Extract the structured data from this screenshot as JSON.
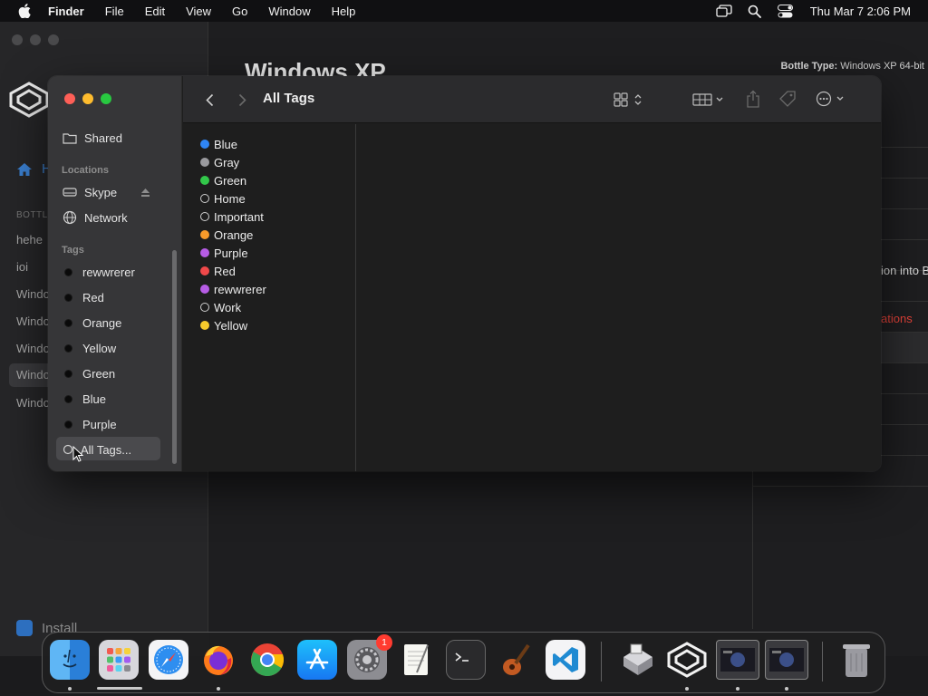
{
  "menubar": {
    "app_name": "Finder",
    "items": [
      "File",
      "Edit",
      "View",
      "Go",
      "Window",
      "Help"
    ],
    "clock": "Thu Mar 7  2:06 PM"
  },
  "background_app": {
    "title": "Windows XP",
    "bottle_type_label": "Bottle Type:",
    "bottle_type_value": "Windows XP 64-bit",
    "sidebar_section": "BOTTLES",
    "sidebar_items": [
      "hehe",
      "ioi",
      "Windows",
      "Windows",
      "Windows",
      "Windows",
      "Windows"
    ],
    "home_label": "Home",
    "install_label": "Install",
    "right_text_1": "ion into B",
    "right_text_2": "ations"
  },
  "finder": {
    "window_title": "All Tags",
    "sidebar": {
      "shared_label": "Shared",
      "locations_header": "Locations",
      "locations": [
        {
          "label": "Skype",
          "icon": "drive-icon"
        },
        {
          "label": "Network",
          "icon": "globe-icon"
        }
      ],
      "tags_header": "Tags",
      "tags": [
        "rewwrerer",
        "Red",
        "Orange",
        "Yellow",
        "Green",
        "Blue",
        "Purple"
      ],
      "all_tags_label": "All Tags..."
    },
    "tag_list": [
      {
        "name": "Blue",
        "color": "#2f86f6",
        "hollow": false
      },
      {
        "name": "Gray",
        "color": "#9a9a9e",
        "hollow": false
      },
      {
        "name": "Green",
        "color": "#32c74a",
        "hollow": false
      },
      {
        "name": "Home",
        "color": "",
        "hollow": true
      },
      {
        "name": "Important",
        "color": "",
        "hollow": true
      },
      {
        "name": "Orange",
        "color": "#f79a2a",
        "hollow": false
      },
      {
        "name": "Purple",
        "color": "#b65ce5",
        "hollow": false
      },
      {
        "name": "Red",
        "color": "#f0494a",
        "hollow": false
      },
      {
        "name": "rewwrerer",
        "color": "#b65ce5",
        "hollow": false
      },
      {
        "name": "Work",
        "color": "",
        "hollow": true
      },
      {
        "name": "Yellow",
        "color": "#f6cb2c",
        "hollow": false
      }
    ]
  },
  "dock": {
    "apps": [
      {
        "name": "Finder",
        "running": true
      },
      {
        "name": "Launchpad",
        "running": false
      },
      {
        "name": "Safari",
        "running": false
      },
      {
        "name": "Firefox",
        "running": true
      },
      {
        "name": "Chrome",
        "running": false
      },
      {
        "name": "App Store",
        "running": false
      },
      {
        "name": "System Settings",
        "running": false,
        "badge": "1"
      },
      {
        "name": "TextEdit",
        "running": false
      },
      {
        "name": "Terminal",
        "running": false
      },
      {
        "name": "GarageBand",
        "running": false
      },
      {
        "name": "Visual Studio Code",
        "running": false
      },
      {
        "name": "Disk Utility",
        "running": false
      },
      {
        "name": "Whisky",
        "running": true
      },
      {
        "name": "Window 1",
        "running": true
      },
      {
        "name": "Window 2",
        "running": true
      },
      {
        "name": "Trash",
        "running": false
      }
    ]
  }
}
